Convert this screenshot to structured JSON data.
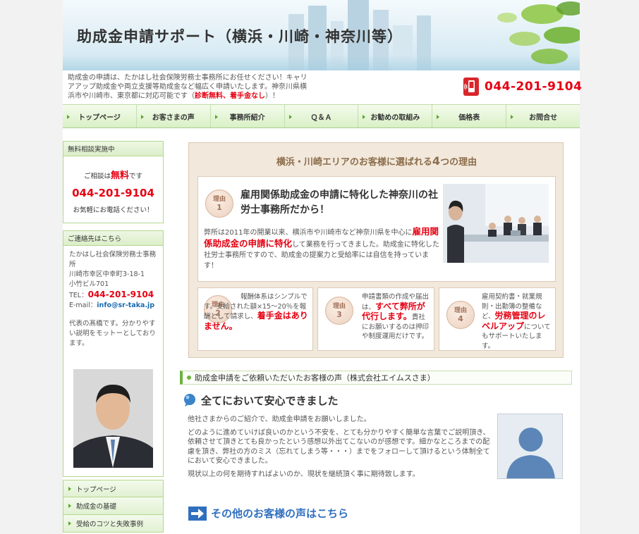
{
  "header": {
    "title": "助成金申請サポート（横浜・川崎・神奈川等）"
  },
  "intro": {
    "text_before": "助成金の申請は、たかはし社会保険労務士事務所にお任せください！キャリアアップ助成金や両立支援等助成金など幅広く申請いたします。神奈川県横浜市や川崎市、東京都に対応可能です（",
    "red_text": "診断無料、着手金なし",
    "text_after": "）！"
  },
  "phone": {
    "number": "044-201-9104",
    "icon": "mobile-phone-icon"
  },
  "nav": {
    "items": [
      "トップページ",
      "お客さまの声",
      "事務所紹介",
      "Ｑ＆Ａ",
      "お勧めの取組み",
      "価格表",
      "お問合せ"
    ]
  },
  "sidebar": {
    "free_consult": {
      "heading": "無料相談実施中",
      "line_before": "ご相談は",
      "line_red": "無料",
      "line_after": "です",
      "tel": "044-201-9104",
      "note": "お気軽にお電話ください！"
    },
    "contact": {
      "heading": "ご連絡先はこちら",
      "office": "たかはし社会保険労務士事務所",
      "address1": "川崎市幸区中幸町3-18-1",
      "address2": "小竹ビル701",
      "tel_label": "TEL：",
      "tel": "044-201-9104",
      "mail_label": "E-mail：",
      "mail": "info@sr-taka.jp",
      "motto": "代表の髙橋です。分かりやすい説明をモットーとしております。"
    },
    "menu": [
      "トップページ",
      "助成金の基礎",
      "受給のコツと失敗事例"
    ]
  },
  "reasons": {
    "title_before": "横浜・川崎エリアのお客様に選ばれる",
    "title_number": "4",
    "title_after": "つの理由",
    "badge_label": "理由",
    "r1": {
      "num": "1",
      "title": "雇用関係助成金の申請に特化した神奈川の社労士事務所だから！",
      "body_before": "弊所は2011年の開業以来、横浜市や川崎市など神奈川県を中心に",
      "body_red": "雇用関係助成金の申請に特化",
      "body_after": "して業務を行ってきました。助成金に特化した社労士事務所ですので、助成金の提案力と受給率には自信を持っています！"
    },
    "r2": {
      "num": "2",
      "text_before": "報酬体系はシンプルです。支給された額×15～20％を報酬として請求し、",
      "text_red": "着手金はありません。"
    },
    "r3": {
      "num": "3",
      "text_before": "申請書類の作成や届出は、",
      "text_red": "すべて弊所が代行します。",
      "text_after": "貴社にお願いするのは押印や制度運用だけです。"
    },
    "r4": {
      "num": "4",
      "text_before": "雇用契約書・就業規則・出勤簿の整備など、",
      "text_red": "労務管理のレベルアップ",
      "text_after": "についてもサポートいたします。"
    }
  },
  "testimonial": {
    "bar": "助成金申請をご依頼いただいたお客様の声（株式会社エイムスさま）",
    "title": "全てにおいて安心できました",
    "title_icon": "speech-bubble-icon",
    "paragraphs": [
      "他社さまからのご紹介で、助成金申請をお願いしました。",
      "どのように進めていけば良いのかという不安を、とても分かりやすく簡単な言葉でご説明頂き、依頼させて頂きとても良かったという感想以外出てこないのが感想です。細かなところまでの配慮を頂き、弊社の方のミス（忘れてしまう等・・・）までをフォローして頂けるという体制全てにおいて安心できました。",
      "現状以上の何を期待すればよいのか、現状を継続頂く事に期待致します。"
    ],
    "more_link": "その他のお客様の声はこちら",
    "more_icon": "right-arrow-icon"
  },
  "colors": {
    "accent_red": "#e60012",
    "nav_green": "#d9f0c6",
    "link_blue": "#2f6fbf"
  }
}
